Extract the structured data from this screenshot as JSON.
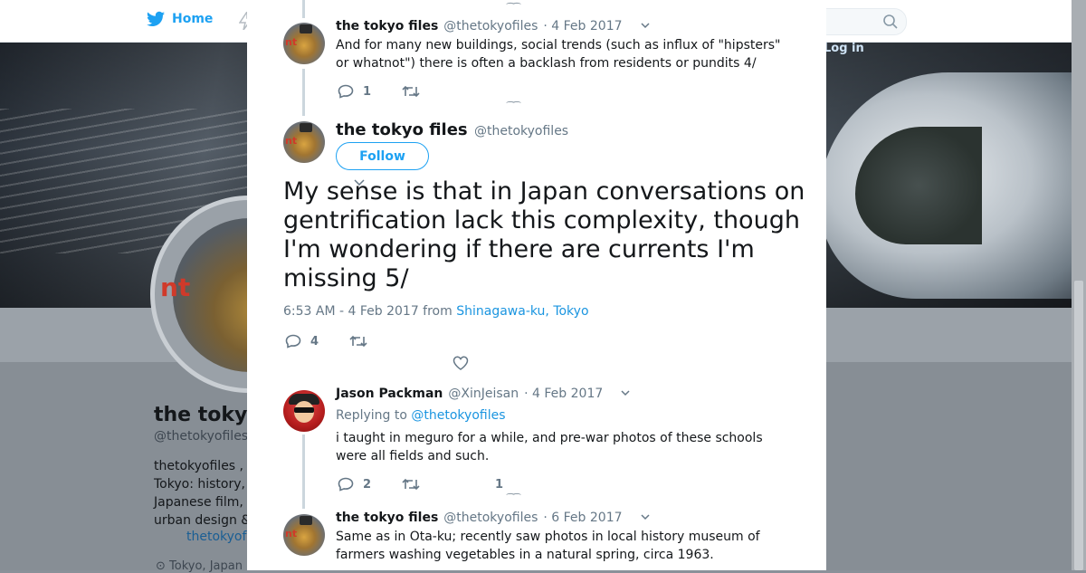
{
  "nav": {
    "home_label": "Home",
    "login_label": "Log in"
  },
  "profile_bg": {
    "name": "the tokyo",
    "handle": "@thetokyofiles",
    "bio_lines": [
      "thetokyofiles ,",
      "Tokyo: history,",
      "Japanese film,",
      "urban design &"
    ],
    "link": "thetokyof",
    "location": "Tokyo, Japan",
    "avatar_text": "nt"
  },
  "tweets": {
    "t1": {
      "name": "the tokyo files",
      "handle": "@thetokyofiles",
      "date": "· 4 Feb 2017",
      "text_line1": "And for many new buildings, social trends (such as influx of \"hipsters\"",
      "text_line2": "or whatnot\") there is often a backlash from residents or pundits 4/",
      "reply_count": "1"
    },
    "main": {
      "name": "the tokyo files",
      "handle": "@thetokyofiles",
      "follow_label": "Follow",
      "text": "My sense is that in Japan conversations on gentrification lack this complexity, though I'm wondering if there are currents I'm missing 5/",
      "meta_time": "6:53 AM - 4 Feb 2017 from",
      "meta_location": "Shinagawa-ku, Tokyo",
      "reply_count": "4"
    },
    "t3": {
      "name": "Jason Packman",
      "handle": "@XinJeisan",
      "date": "· 4 Feb 2017",
      "replying_label": "Replying to",
      "replying_to": "@thetokyofiles",
      "text_line1": "i taught in meguro for a while, and pre-war photos of these schools",
      "text_line2": "were all fields and such.",
      "reply_count": "2",
      "like_count": "1"
    },
    "t4": {
      "name": "the tokyo files",
      "handle": "@thetokyofiles",
      "date": "· 6 Feb 2017",
      "text_line1": "Same as in Ota-ku; recently saw photos in local history museum of",
      "text_line2": "farmers washing vegetables in a natural spring, circa 1963."
    }
  },
  "colors": {
    "accent": "#1da1f2",
    "link": "#1b95e0",
    "muted": "#657786",
    "text": "#14171a"
  }
}
